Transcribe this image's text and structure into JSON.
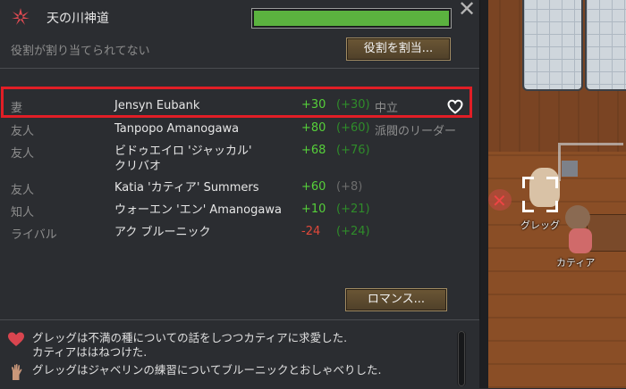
{
  "header": {
    "ideoligion_name": "天の川神道",
    "role_text": "役割が割り当てられてない",
    "assign_role_label": "役割を割当...",
    "close_glyph": "✕",
    "mood_fill": 1.0
  },
  "relations": [
    {
      "type": "妻",
      "name": "Jensyn Eubank",
      "opinion": "+30",
      "their_opinion": "(+30)",
      "status": "中立",
      "has_heart": true,
      "dim": false,
      "negative": false
    },
    {
      "type": "友人",
      "name": "Tanpopo Amanogawa",
      "opinion": "+80",
      "their_opinion": "(+60)",
      "status": "派閥のリーダー",
      "has_heart": false,
      "dim": false,
      "negative": false
    },
    {
      "type": "友人",
      "name": "ビドゥエイロ 'ジャッカル'\nクリバオ",
      "opinion": "+68",
      "their_opinion": "(+76)",
      "status": "",
      "has_heart": false,
      "dim": false,
      "negative": false
    },
    {
      "type": "友人",
      "name": "Katia 'カティア' Summers",
      "opinion": "+60",
      "their_opinion": "(+8)",
      "status": "",
      "has_heart": false,
      "dim": true,
      "negative": false
    },
    {
      "type": "知人",
      "name": "ウォーエン 'エン' Amanogawa",
      "opinion": "+10",
      "their_opinion": "(+21)",
      "status": "",
      "has_heart": false,
      "dim": false,
      "negative": false
    },
    {
      "type": "ライバル",
      "name": "アク ブルーニック",
      "opinion": "-24",
      "their_opinion": "(+24)",
      "status": "",
      "has_heart": false,
      "dim": false,
      "negative": true
    }
  ],
  "romance_label": "ロマンス...",
  "log": [
    {
      "icon": "heart-icon",
      "line1": "グレッグは不満の種についての話をしつつカティアに求愛した.",
      "line2": "カティアははねつけた."
    },
    {
      "icon": "hand-icon",
      "line1": "グレッグはジャベリンの練習についてブルーニックとおしゃべりした.",
      "line2": ""
    }
  ],
  "world": {
    "pawn_labels": [
      "グレッグ",
      "カティア"
    ]
  },
  "colors": {
    "positive": "#56d03a",
    "negative": "#e0483a",
    "highlight": "#e11e26",
    "mood_bar": "#5bb23f"
  }
}
